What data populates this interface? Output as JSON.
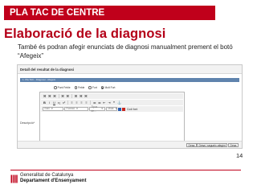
{
  "slide": {
    "banner": "PLA TAC DE CENTRE",
    "title": "Elaboració de la diagnosi",
    "body": "També és podran afegir enunciats de diagnosi manualment prement el botó “Afegeix”",
    "page_number": "14"
  },
  "screenshot": {
    "section_title": "Detall del resultat de la diagnosi",
    "tab_label": "1. Pla TAC - Diagnosi - Afegeix",
    "type_options": [
      {
        "label": "Punt Feble",
        "selected": false
      },
      {
        "label": "Feble",
        "selected": false
      },
      {
        "label": "Fort",
        "selected": false
      },
      {
        "label": "Molt Fort",
        "selected": true
      }
    ],
    "toolbar": {
      "row1": [
        "Font",
        "Style",
        "Size",
        "Color",
        "⌘",
        "⌘",
        "⌘",
        "⌘",
        "⌘",
        "⌘",
        "⌘",
        "⌘"
      ],
      "row2": [
        "B",
        "I",
        "U",
        "x₂",
        "x²",
        "≡",
        "≡",
        "≡",
        "≡",
        "≔",
        "≔",
        "⇤",
        "⇥",
        "❝",
        "⚓"
      ],
      "combos": [
        "Estil",
        "Format",
        "Tipus de...",
        "Mida"
      ],
      "colors": [
        "#2a5db0",
        "#c8261e"
      ],
      "code_button": "Codi font"
    },
    "description_label": "Descripció*",
    "buttons": {
      "save": "Desa",
      "save_add": "Desa i segueix afegint",
      "back": "Desa"
    }
  },
  "footer": {
    "org_line1": "Generalitat de Catalunya",
    "org_line2": "Departament d'Ensenyament",
    "brand_color": "#c0001b"
  }
}
